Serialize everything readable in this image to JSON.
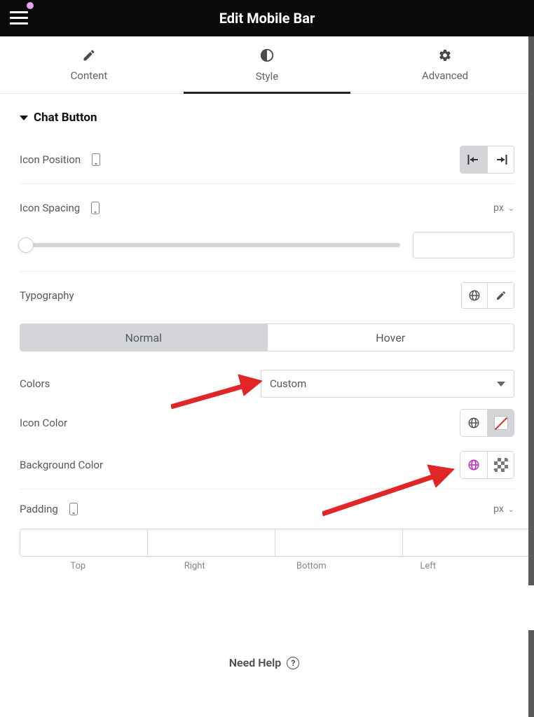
{
  "header": {
    "title": "Edit Mobile Bar"
  },
  "tabs": {
    "content": "Content",
    "style": "Style",
    "advanced": "Advanced"
  },
  "section": {
    "title": "Chat Button"
  },
  "iconPosition": {
    "label": "Icon Position"
  },
  "iconSpacing": {
    "label": "Icon Spacing",
    "unit": "px"
  },
  "typography": {
    "label": "Typography"
  },
  "stateToggle": {
    "normal": "Normal",
    "hover": "Hover"
  },
  "colors": {
    "label": "Colors",
    "value": "Custom"
  },
  "iconColor": {
    "label": "Icon Color"
  },
  "bgColor": {
    "label": "Background Color"
  },
  "padding": {
    "label": "Padding",
    "unit": "px",
    "sides": {
      "top": "Top",
      "right": "Right",
      "bottom": "Bottom",
      "left": "Left"
    }
  },
  "help": {
    "label": "Need Help"
  }
}
